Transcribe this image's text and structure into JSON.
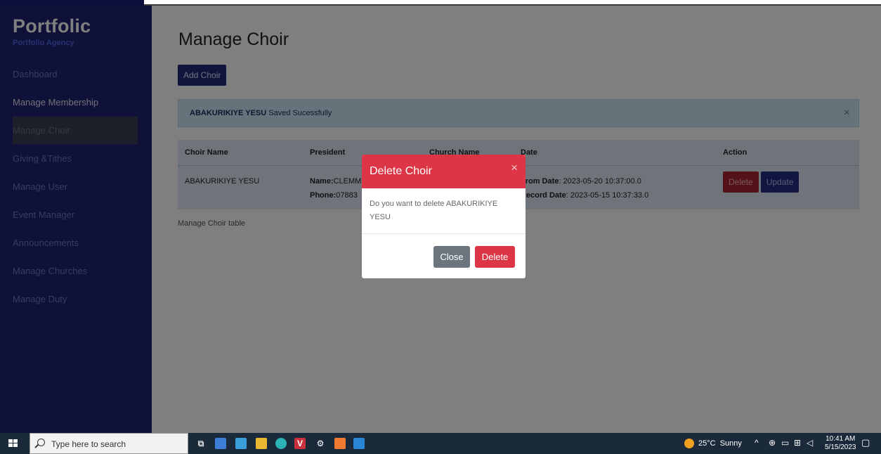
{
  "sidebar": {
    "brand_title": "Portfolic",
    "brand_subtitle": "Portfolio Agency",
    "items": [
      {
        "label": "Dashboard"
      },
      {
        "label": "Manage Membership"
      },
      {
        "label": "Manage Choir"
      },
      {
        "label": "Giving &Tithes"
      },
      {
        "label": "Manage User"
      },
      {
        "label": "Event Manager"
      },
      {
        "label": "Announcements"
      },
      {
        "label": "Manage Churches"
      },
      {
        "label": "Manage Duty"
      }
    ]
  },
  "main": {
    "title": "Manage Choir",
    "add_button": "Add Choir",
    "alert": {
      "bold": "ABAKURIKIYE YESU",
      "text": " Saved Sucessfully",
      "close": "×"
    },
    "table": {
      "headers": [
        "Choir Name",
        "President",
        "Church Name",
        "Date",
        "Action"
      ],
      "row": {
        "choir_name": "ABAKURIKIYE YESU",
        "president_name_label": "Name:",
        "president_name": "CLEMM",
        "president_phone_label": "Phone:",
        "president_phone": "07883",
        "from_date_label": "From Date",
        "from_date": ": 2023-05-20 10:37:00.0",
        "record_date_label": "Record Date",
        "record_date": ": 2023-05-15 10:37:33.0",
        "delete": "Delete",
        "update": "Update"
      }
    },
    "caption": "Manage Choir table"
  },
  "modal": {
    "title": "Delete Choir",
    "close_x": "×",
    "body": "Do you want to delete ABAKURIKIYE YESU",
    "close_button": "Close",
    "delete_button": "Delete"
  },
  "taskbar": {
    "search_placeholder": "Type here to search",
    "weather": "25°C  Sunny",
    "time": "10:41 AM",
    "date": "5/15/2023"
  },
  "colors": {
    "sidebar": "#1e2270",
    "modal_header": "#dc3545",
    "close_button": "#6c757d",
    "primary": "#222a7a"
  }
}
